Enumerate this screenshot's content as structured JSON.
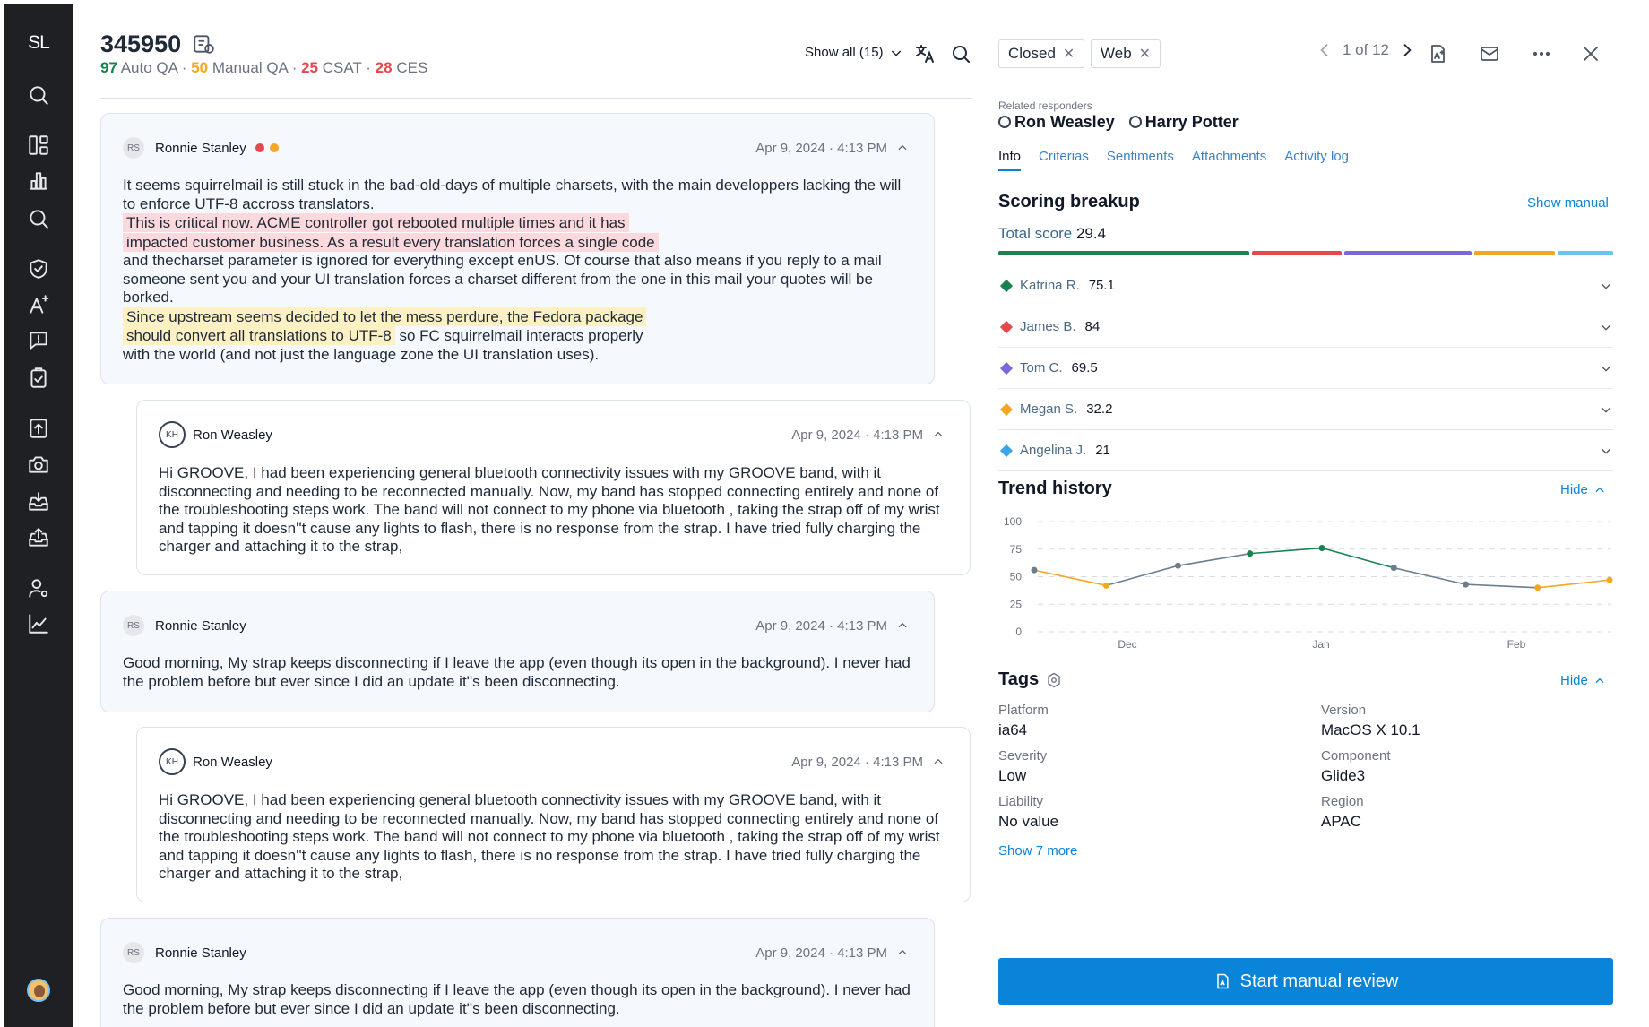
{
  "sidebar": {
    "logo": "SL",
    "icons": [
      "search-icon",
      "dashboard-icon",
      "bar-chart-icon",
      "search-icon",
      "shield-check-icon",
      "ai-text-icon",
      "feedback-icon",
      "clipboard-check-icon",
      "upload-icon",
      "camera-icon",
      "inbox-in-icon",
      "inbox-out-icon",
      "user-settings-icon",
      "trend-chart-icon"
    ]
  },
  "conversation": {
    "ticket_id": "345950",
    "scores": {
      "auto_qa_value": "97",
      "auto_qa_label": "Auto QA",
      "manual_qa_value": "50",
      "manual_qa_label": "Manual QA",
      "csat_value": "25",
      "csat_label": "CSAT",
      "ces_value": "28",
      "ces_label": "CES",
      "sep": "·"
    },
    "show_all": "Show all (15)",
    "messages": [
      {
        "author": "Ronnie Stanley",
        "initials": "RS",
        "date": "Apr 9, 2024 · 4:13 PM",
        "p1": "It seems squirrelmail is still stuck in the bad-old-days of multiple charsets, with the main developpers lacking the will to enforce UTF-8 accross translators.",
        "hl_red_1": "This is critical now. ACME controller got rebooted multiple times and it has",
        "hl_red_2": "impacted customer business. As a result every translation forces a single code",
        "p2": "and thecharset parameter is ignored for everything except enUS. Of course that also means if you reply to a mail someone sent you and your UI translation forces a charset different from the one in this mail your quotes will be borked.",
        "hl_yellow_1": "Since upstream seems decided to  let the mess perdure, the Fedora package",
        "hl_yellow_2": "should convert all translations to UTF-8",
        "p3": " so FC squirrelmail interacts properly",
        "p4": "with the world (and not just the language zone the UI translation uses)."
      },
      {
        "author": "Ron Weasley",
        "initials": "KH",
        "date": "Apr 9, 2024 · 4:13 PM",
        "text": "Hi GROOVE, I had been experiencing general bluetooth connectivity issues with my GROOVE band, with it disconnecting and needing to be reconnected manually. Now, my band has stopped connecting entirely and none of the troubleshooting steps work. The band will not connect to my phone  via bluetooth , taking the strap off of my wrist and tapping it doesn''t cause any lights to flash, there is  no response  from the strap. I have tried fully charging the charger and attaching it to the strap,"
      },
      {
        "author": "Ronnie Stanley",
        "initials": "RS",
        "date": "Apr 9, 2024 · 4:13 PM",
        "text": "Good morning, My strap keeps disconnecting if I leave the app (even though its open in the background). I never had the problem before but ever since I did an update it''s been disconnecting."
      },
      {
        "author": "Ron Weasley",
        "initials": "KH",
        "date": "Apr 9, 2024 · 4:13 PM",
        "text": "Hi GROOVE, I had been experiencing general bluetooth connectivity issues with my GROOVE band, with it disconnecting and needing to be reconnected manually. Now, my band has stopped connecting entirely and none of the troubleshooting steps work. The band will not connect to my phone  via bluetooth , taking the strap off of my wrist and tapping it doesn''t cause any lights to flash, there is  no response  from the strap. I have tried fully charging the charger and attaching it to the strap,"
      },
      {
        "author": "Ronnie Stanley",
        "initials": "RS",
        "date": "Apr 9, 2024 · 4:13 PM",
        "text": "Good morning, My strap keeps disconnecting if I leave the app (even though its open in the background). I never had the problem before but ever since I did an update it''s been disconnecting."
      }
    ]
  },
  "panel": {
    "chips": [
      "Closed",
      "Web"
    ],
    "pager": "1 of 12",
    "related_label": "Related responders",
    "related": [
      "Ron Weasley",
      "Harry Potter"
    ],
    "tabs": [
      "Info",
      "Criterias",
      "Sentiments",
      "Attachments",
      "Activity log"
    ],
    "scoring_title": "Scoring breakup",
    "show_manual": "Show manual",
    "total_label": "Total score",
    "total_value": "29.4",
    "scorers": [
      {
        "name": "Katrina R.",
        "value": "75.1",
        "color": "#16834f"
      },
      {
        "name": "James B.",
        "value": "84",
        "color": "#e5484d"
      },
      {
        "name": "Tom C.",
        "value": "69.5",
        "color": "#7b68d8"
      },
      {
        "name": "Megan S.",
        "value": "32.2",
        "color": "#f5a623"
      },
      {
        "name": "Angelina J.",
        "value": "21",
        "color": "#3ba4e8"
      }
    ],
    "bar_segments": [
      {
        "color": "#16834f",
        "weight": 280
      },
      {
        "color": "#e5484d",
        "weight": 100
      },
      {
        "color": "#7b68d8",
        "weight": 142
      },
      {
        "color": "#f5a623",
        "weight": 90
      },
      {
        "color": "#6cc3ec",
        "weight": 62
      }
    ],
    "trend_title": "Trend history",
    "hide": "Hide",
    "tags_title": "Tags",
    "tags": [
      {
        "key": "Platform",
        "value": "ia64"
      },
      {
        "key": "Version",
        "value": "MacOS X 10.1"
      },
      {
        "key": "Severity",
        "value": "Low"
      },
      {
        "key": "Component",
        "value": "Glide3"
      },
      {
        "key": "Liability",
        "value": "No value"
      },
      {
        "key": "Region",
        "value": "APAC"
      }
    ],
    "show_more": "Show 7 more",
    "start_review": "Start manual review"
  },
  "chart_data": {
    "type": "line",
    "y_ticks": [
      "100",
      "75",
      "50",
      "25",
      "0"
    ],
    "ylim": [
      0,
      100
    ],
    "x_labels": [
      "Dec",
      "Jan",
      "Feb"
    ],
    "points": [
      56,
      42,
      60,
      71,
      76,
      58,
      43,
      40,
      47
    ],
    "segment_colors": [
      "#f5a623",
      "#6b7d8f",
      "#6b7d8f",
      "#16834f",
      "#16834f",
      "#6b7d8f",
      "#6b7d8f",
      "#f5a623"
    ],
    "point_colors": [
      "#6b7d8f",
      "#f5a623",
      "#6b7d8f",
      "#16834f",
      "#16834f",
      "#6b7d8f",
      "#6b7d8f",
      "#f5a623",
      "#f5a623"
    ]
  }
}
